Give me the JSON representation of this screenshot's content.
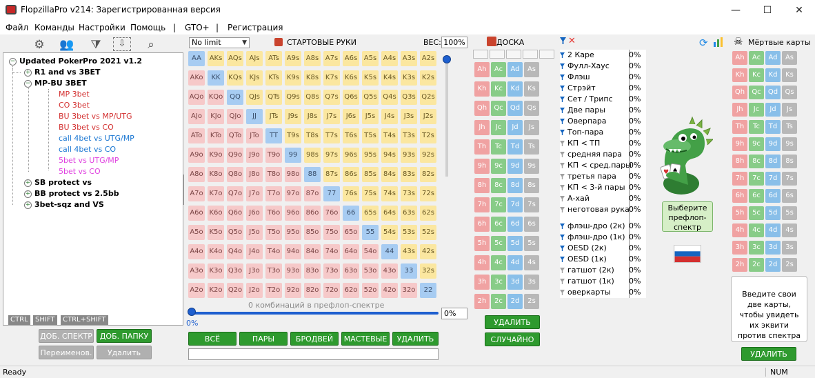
{
  "window": {
    "title": "FlopzillaPro v214: Зарегистрированная версия",
    "minimize": "—",
    "maximize": "☐",
    "close": "✕"
  },
  "menu": [
    "Файл",
    "Команды",
    "Настройки",
    "Помощь",
    "|",
    "GTO+",
    "|",
    "Регистрация"
  ],
  "tree": {
    "toolbar_icons": [
      "gear-icon",
      "users-icon",
      "add-filter-icon",
      "import-icon",
      "search-icon"
    ],
    "items": [
      {
        "label": "Updated PokerPro 2021 v1.2",
        "level": 0,
        "toggle": "−",
        "bold": true,
        "color": "#000000"
      },
      {
        "label": "R1 and vs 3BET",
        "level": 1,
        "toggle": "+",
        "bold": true,
        "color": "#000000"
      },
      {
        "label": "MP-BU 3BET",
        "level": 1,
        "toggle": "−",
        "bold": true,
        "color": "#000000"
      },
      {
        "label": "MP 3bet",
        "level": 2,
        "toggle": "",
        "bold": false,
        "color": "#d32f2f"
      },
      {
        "label": "CO 3bet",
        "level": 2,
        "toggle": "",
        "bold": false,
        "color": "#d32f2f"
      },
      {
        "label": "BU 3bet vs MP/UTG",
        "level": 2,
        "toggle": "",
        "bold": false,
        "color": "#d32f2f"
      },
      {
        "label": "BU 3bet vs CO",
        "level": 2,
        "toggle": "",
        "bold": false,
        "color": "#d32f2f"
      },
      {
        "label": "call 4bet vs UTG/MP",
        "level": 2,
        "toggle": "",
        "bold": false,
        "color": "#1976d2"
      },
      {
        "label": "call 4bet vs CO",
        "level": 2,
        "toggle": "",
        "bold": false,
        "color": "#1976d2"
      },
      {
        "label": "5bet vs UTG/MP",
        "level": 2,
        "toggle": "",
        "bold": false,
        "color": "#e040e0"
      },
      {
        "label": "5bet vs CO",
        "level": 2,
        "toggle": "",
        "bold": false,
        "color": "#e040e0"
      },
      {
        "label": "SB protect vs",
        "level": 1,
        "toggle": "+",
        "bold": true,
        "color": "#000000"
      },
      {
        "label": "BB protect vs 2.5bb",
        "level": 1,
        "toggle": "+",
        "bold": true,
        "color": "#000000"
      },
      {
        "label": "3bet-sqz and VS",
        "level": 1,
        "toggle": "+",
        "bold": true,
        "color": "#000000"
      }
    ],
    "key_tags": [
      "CTRL",
      "SHIFT",
      "CTRL+SHIFT"
    ],
    "buttons": {
      "add_range": "ДОБ. СПЕКТР",
      "add_folder": "ДОБ. ПАПКУ",
      "rename": "Переименов.",
      "delete": "Удалить"
    }
  },
  "range": {
    "limit": "No limit",
    "title": "СТАРТОВЫЕ РУКИ",
    "weight_label": "ВЕС:",
    "weight": "100%",
    "ranks": [
      "A",
      "K",
      "Q",
      "J",
      "T",
      "9",
      "8",
      "7",
      "6",
      "5",
      "4",
      "3",
      "2"
    ],
    "combos_text": "0 комбинаций в префлоп-спектре",
    "slider_value": "0%",
    "slider_fraction": 0,
    "pct_box": "0%",
    "buttons": [
      "ВСЁ",
      "ПАРЫ",
      "БРОДВЕЙ",
      "МАСТЕВЫЕ",
      "УДАЛИТЬ"
    ]
  },
  "board": {
    "title": "ДОСКА",
    "cards": [
      "Ah",
      "Ac",
      "Ad",
      "As",
      "Kh",
      "Kc",
      "Kd",
      "Ks",
      "Qh",
      "Qc",
      "Qd",
      "Qs",
      "Jh",
      "Jc",
      "Jd",
      "Js",
      "Th",
      "Tc",
      "Td",
      "Ts",
      "9h",
      "9c",
      "9d",
      "9s",
      "8h",
      "8c",
      "8d",
      "8s",
      "7h",
      "7c",
      "7d",
      "7s",
      "6h",
      "6c",
      "6d",
      "6s",
      "5h",
      "5c",
      "5d",
      "5s",
      "4h",
      "4c",
      "4d",
      "4s",
      "3h",
      "3c",
      "3d",
      "3s",
      "2h",
      "2c",
      "2d",
      "2s"
    ],
    "delete": "УДАЛИТЬ",
    "random": "СЛУЧАЙНО"
  },
  "stats": {
    "hands": [
      {
        "label": "2 Каре",
        "pct": "0%",
        "active": true
      },
      {
        "label": "Фулл-Хаус",
        "pct": "0%",
        "active": true
      },
      {
        "label": "Флэш",
        "pct": "0%",
        "active": true
      },
      {
        "label": "Стрэйт",
        "pct": "0%",
        "active": true
      },
      {
        "label": "Сет / Трипс",
        "pct": "0%",
        "active": true
      },
      {
        "label": "Две пары",
        "pct": "0%",
        "active": true
      },
      {
        "label": "Оверпара",
        "pct": "0%",
        "active": true
      },
      {
        "label": "Топ-пара",
        "pct": "0%",
        "active": true
      },
      {
        "label": "КП < ТП",
        "pct": "0%",
        "active": false
      },
      {
        "label": "средняя пара",
        "pct": "0%",
        "active": false
      },
      {
        "label": "КП < сред.пары",
        "pct": "0%",
        "active": false
      },
      {
        "label": "третья пара",
        "pct": "0%",
        "active": false
      },
      {
        "label": "КП < 3-й пары",
        "pct": "0%",
        "active": false
      },
      {
        "label": "А-хай",
        "pct": "0%",
        "active": false
      },
      {
        "label": "неготовая рука",
        "pct": "0%",
        "active": false
      }
    ],
    "draws": [
      {
        "label": "флэш-дро (2к)",
        "pct": "0%",
        "active": true
      },
      {
        "label": "флэш-дро (1к)",
        "pct": "0%",
        "active": true
      },
      {
        "label": "OESD (2к)",
        "pct": "0%",
        "active": true
      },
      {
        "label": "OESD (1к)",
        "pct": "0%",
        "active": true
      },
      {
        "label": "гатшот (2к)",
        "pct": "0%",
        "active": false
      },
      {
        "label": "гатшот (1к)",
        "pct": "0%",
        "active": false
      },
      {
        "label": "оверкарты",
        "pct": "0%",
        "active": false
      }
    ]
  },
  "right": {
    "preflop_button": "Выберите префлоп-спектр",
    "dead_title": "Мёртвые карты",
    "dead_hint": "Введите свои две карты, чтобы увидеть их эквити против спектра",
    "delete": "УДАЛИТЬ"
  },
  "status": {
    "left": "Ready",
    "right": "NUM"
  },
  "colors": {
    "accent": "#2e9a2e",
    "pair": "#a7ccf2",
    "suited": "#fbe7a0",
    "offsuit": "#f6c9c9",
    "hearts": "#f0a2a2",
    "clubs": "#88cc88",
    "diamonds": "#89bfe9",
    "spades": "#b8b8b8"
  }
}
